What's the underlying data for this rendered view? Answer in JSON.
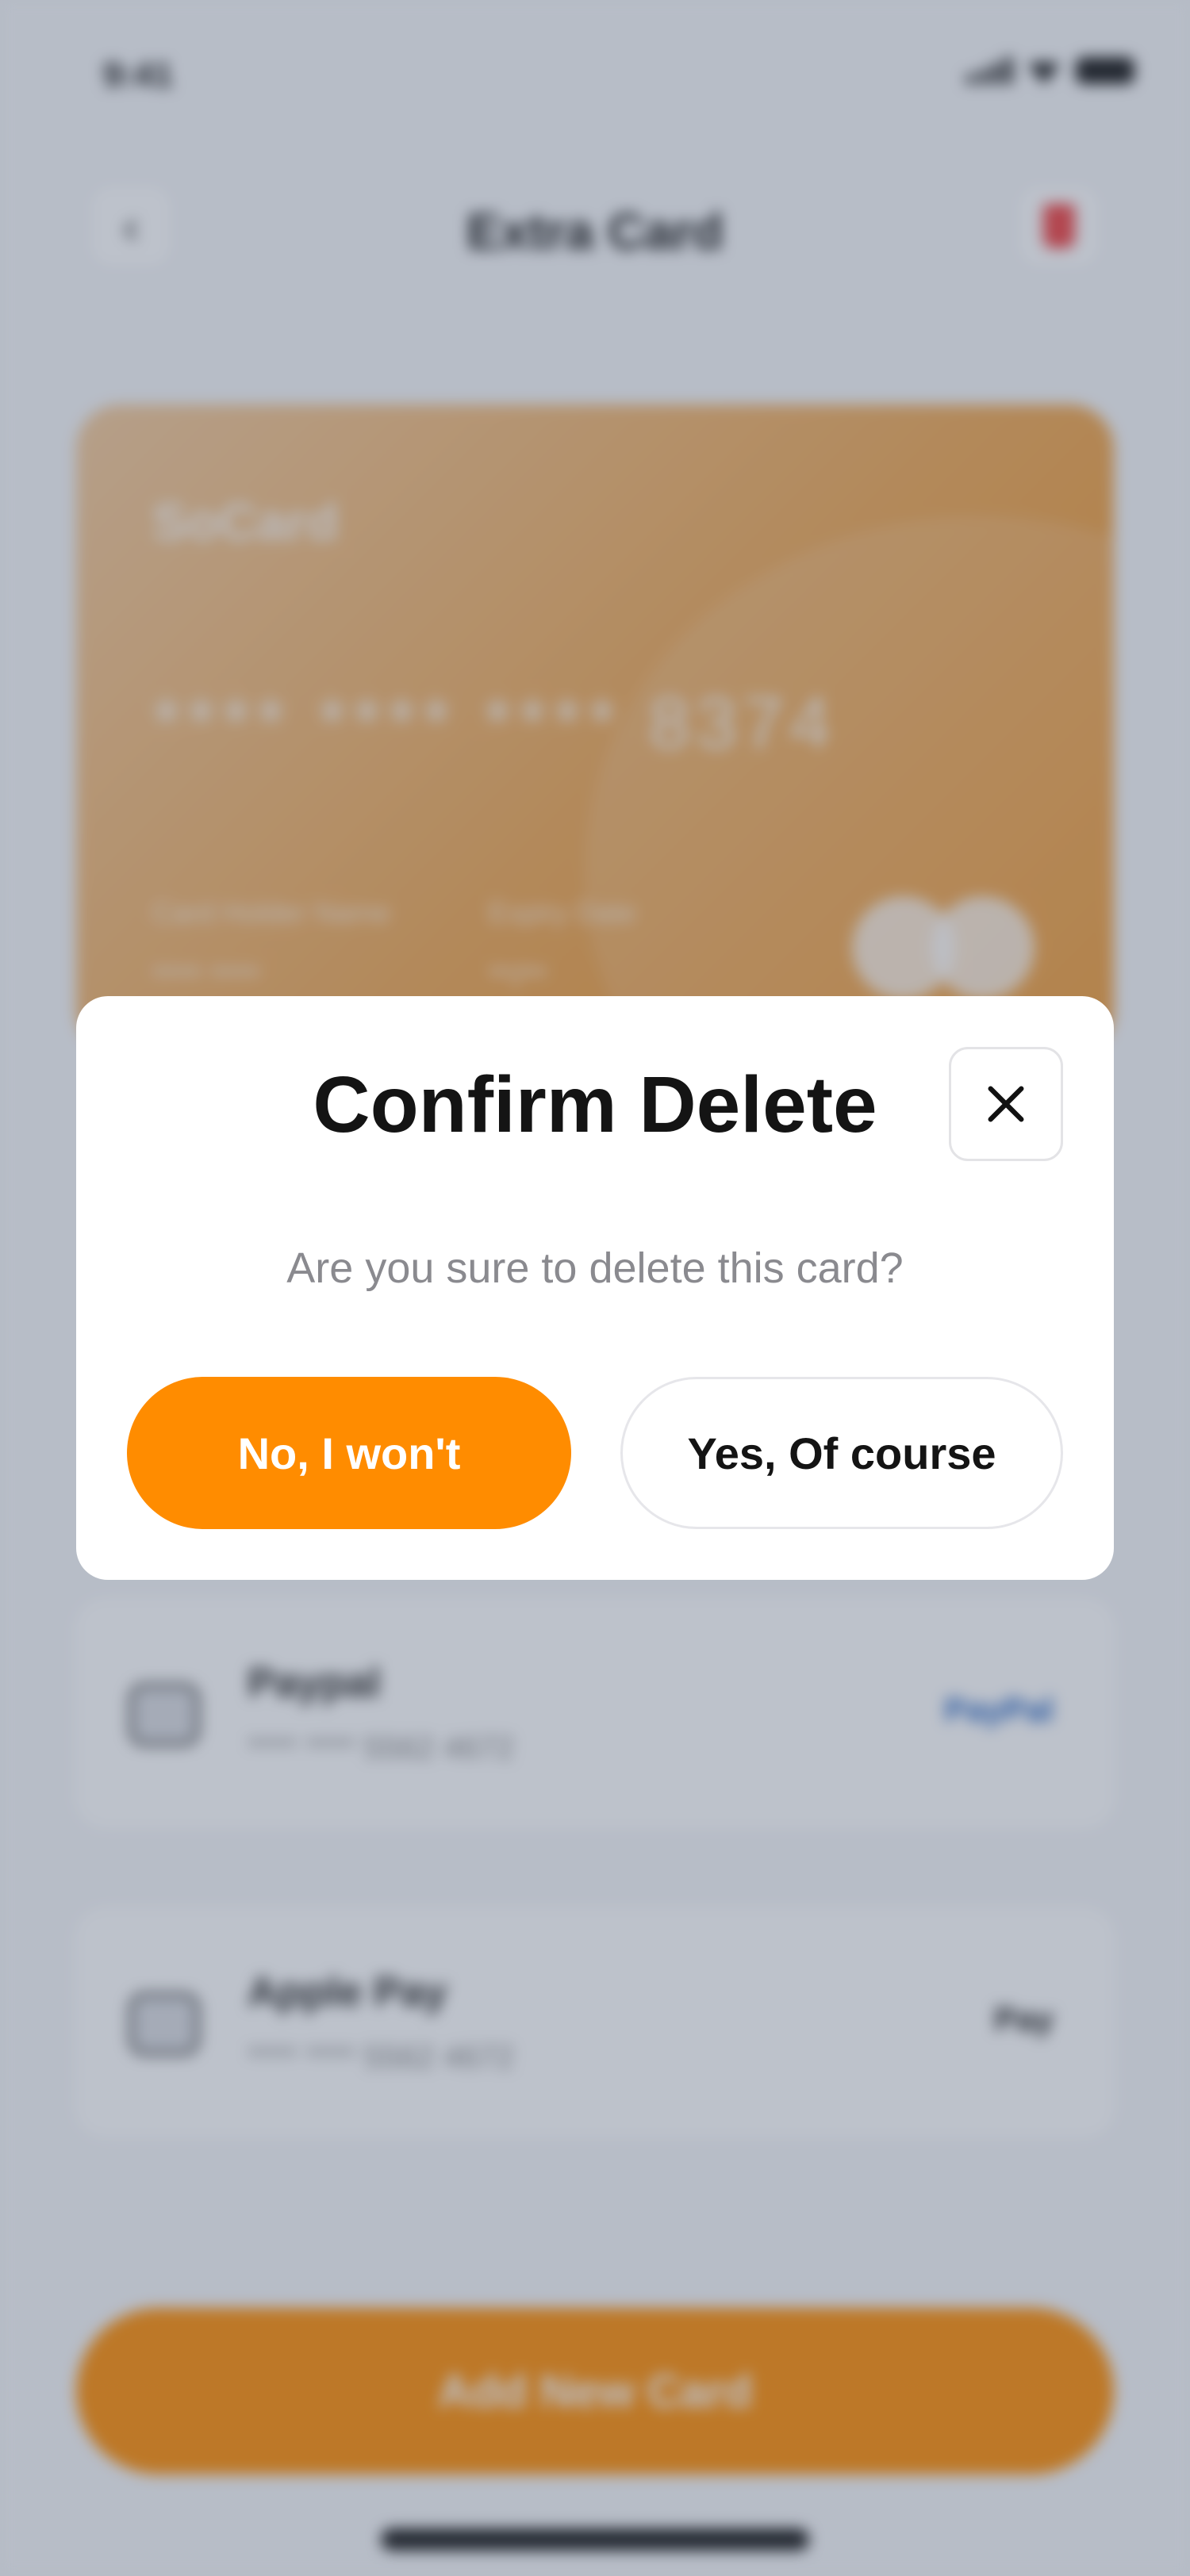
{
  "status_bar": {
    "time": "9:41"
  },
  "header": {
    "title": "Extra Card"
  },
  "card": {
    "brand": "SoCard",
    "number": "**** **** **** 8374",
    "holder_label": "Card Holder Name",
    "holder_value": "**** ****",
    "expiry_label": "Expiry Date",
    "expiry_value": "**/**"
  },
  "payment_methods": [
    {
      "name": "Paypal",
      "number": "**** **** 5562 4672",
      "brand": "PayPal",
      "brand_color": "#1f5fbf"
    },
    {
      "name": "Apple Pay",
      "number": "**** **** 5562 4672",
      "brand": "Pay",
      "brand_color": "#111111"
    }
  ],
  "add_button": {
    "label": "Add New Card"
  },
  "modal": {
    "title": "Confirm Delete",
    "message": "Are you sure to delete this card?",
    "no_label": "No, I won't",
    "yes_label": "Yes, Of course",
    "close_icon": "close-icon"
  },
  "colors": {
    "accent": "#ff8c00",
    "overlay": "#48566e"
  }
}
